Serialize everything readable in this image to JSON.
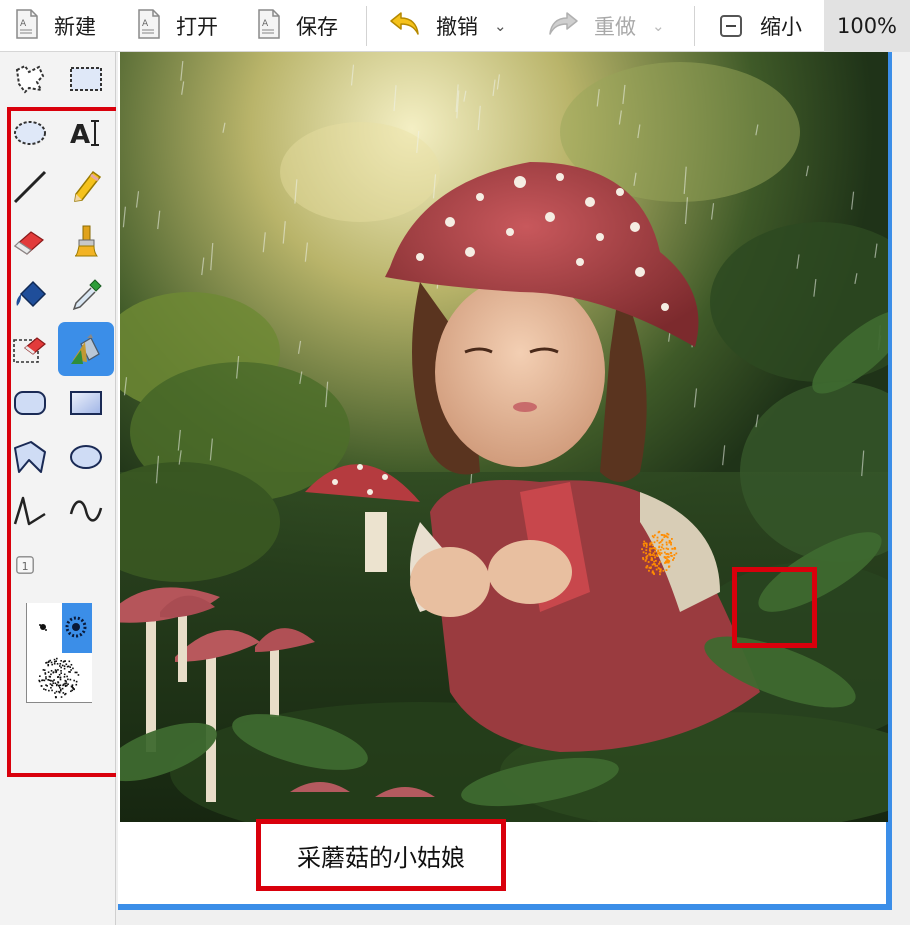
{
  "toolbar": {
    "new_label": "新建",
    "open_label": "打开",
    "save_label": "保存",
    "undo_label": "撤销",
    "redo_label": "重做",
    "zoom_out_label": "缩小",
    "zoom_value": "100%"
  },
  "tools": [
    {
      "name": "free-select-tool",
      "icon": "lasso-icon"
    },
    {
      "name": "rect-select-tool",
      "icon": "rect-select-icon"
    },
    {
      "name": "ellipse-select-tool",
      "icon": "ellipse-select-icon"
    },
    {
      "name": "text-tool",
      "icon": "text-icon"
    },
    {
      "name": "line-tool",
      "icon": "line-icon"
    },
    {
      "name": "pencil-tool",
      "icon": "pencil-icon"
    },
    {
      "name": "eraser-tool",
      "icon": "eraser-icon"
    },
    {
      "name": "brush-tool",
      "icon": "brush-icon"
    },
    {
      "name": "fill-tool",
      "icon": "paint-bucket-icon"
    },
    {
      "name": "color-picker-tool",
      "icon": "eyedropper-icon"
    },
    {
      "name": "selection-eraser-tool",
      "icon": "eraser-selection-icon"
    },
    {
      "name": "airbrush-tool",
      "icon": "spray-can-icon",
      "active": true
    },
    {
      "name": "rounded-rect-tool",
      "icon": "rounded-rect-icon"
    },
    {
      "name": "rectangle-tool",
      "icon": "rectangle-icon"
    },
    {
      "name": "polygon-tool",
      "icon": "polygon-icon"
    },
    {
      "name": "ellipse-tool",
      "icon": "ellipse-icon"
    },
    {
      "name": "polyline-tool",
      "icon": "polyline-icon"
    },
    {
      "name": "curve-tool",
      "icon": "curve-icon"
    },
    {
      "name": "tool-size-option",
      "icon": "size-option-icon"
    }
  ],
  "canvas": {
    "caption": "采蘑菇的小姑娘"
  },
  "colors": {
    "accent": "#3b8ee8",
    "annotation": "#d9000c",
    "spray": "#ff8c00"
  }
}
